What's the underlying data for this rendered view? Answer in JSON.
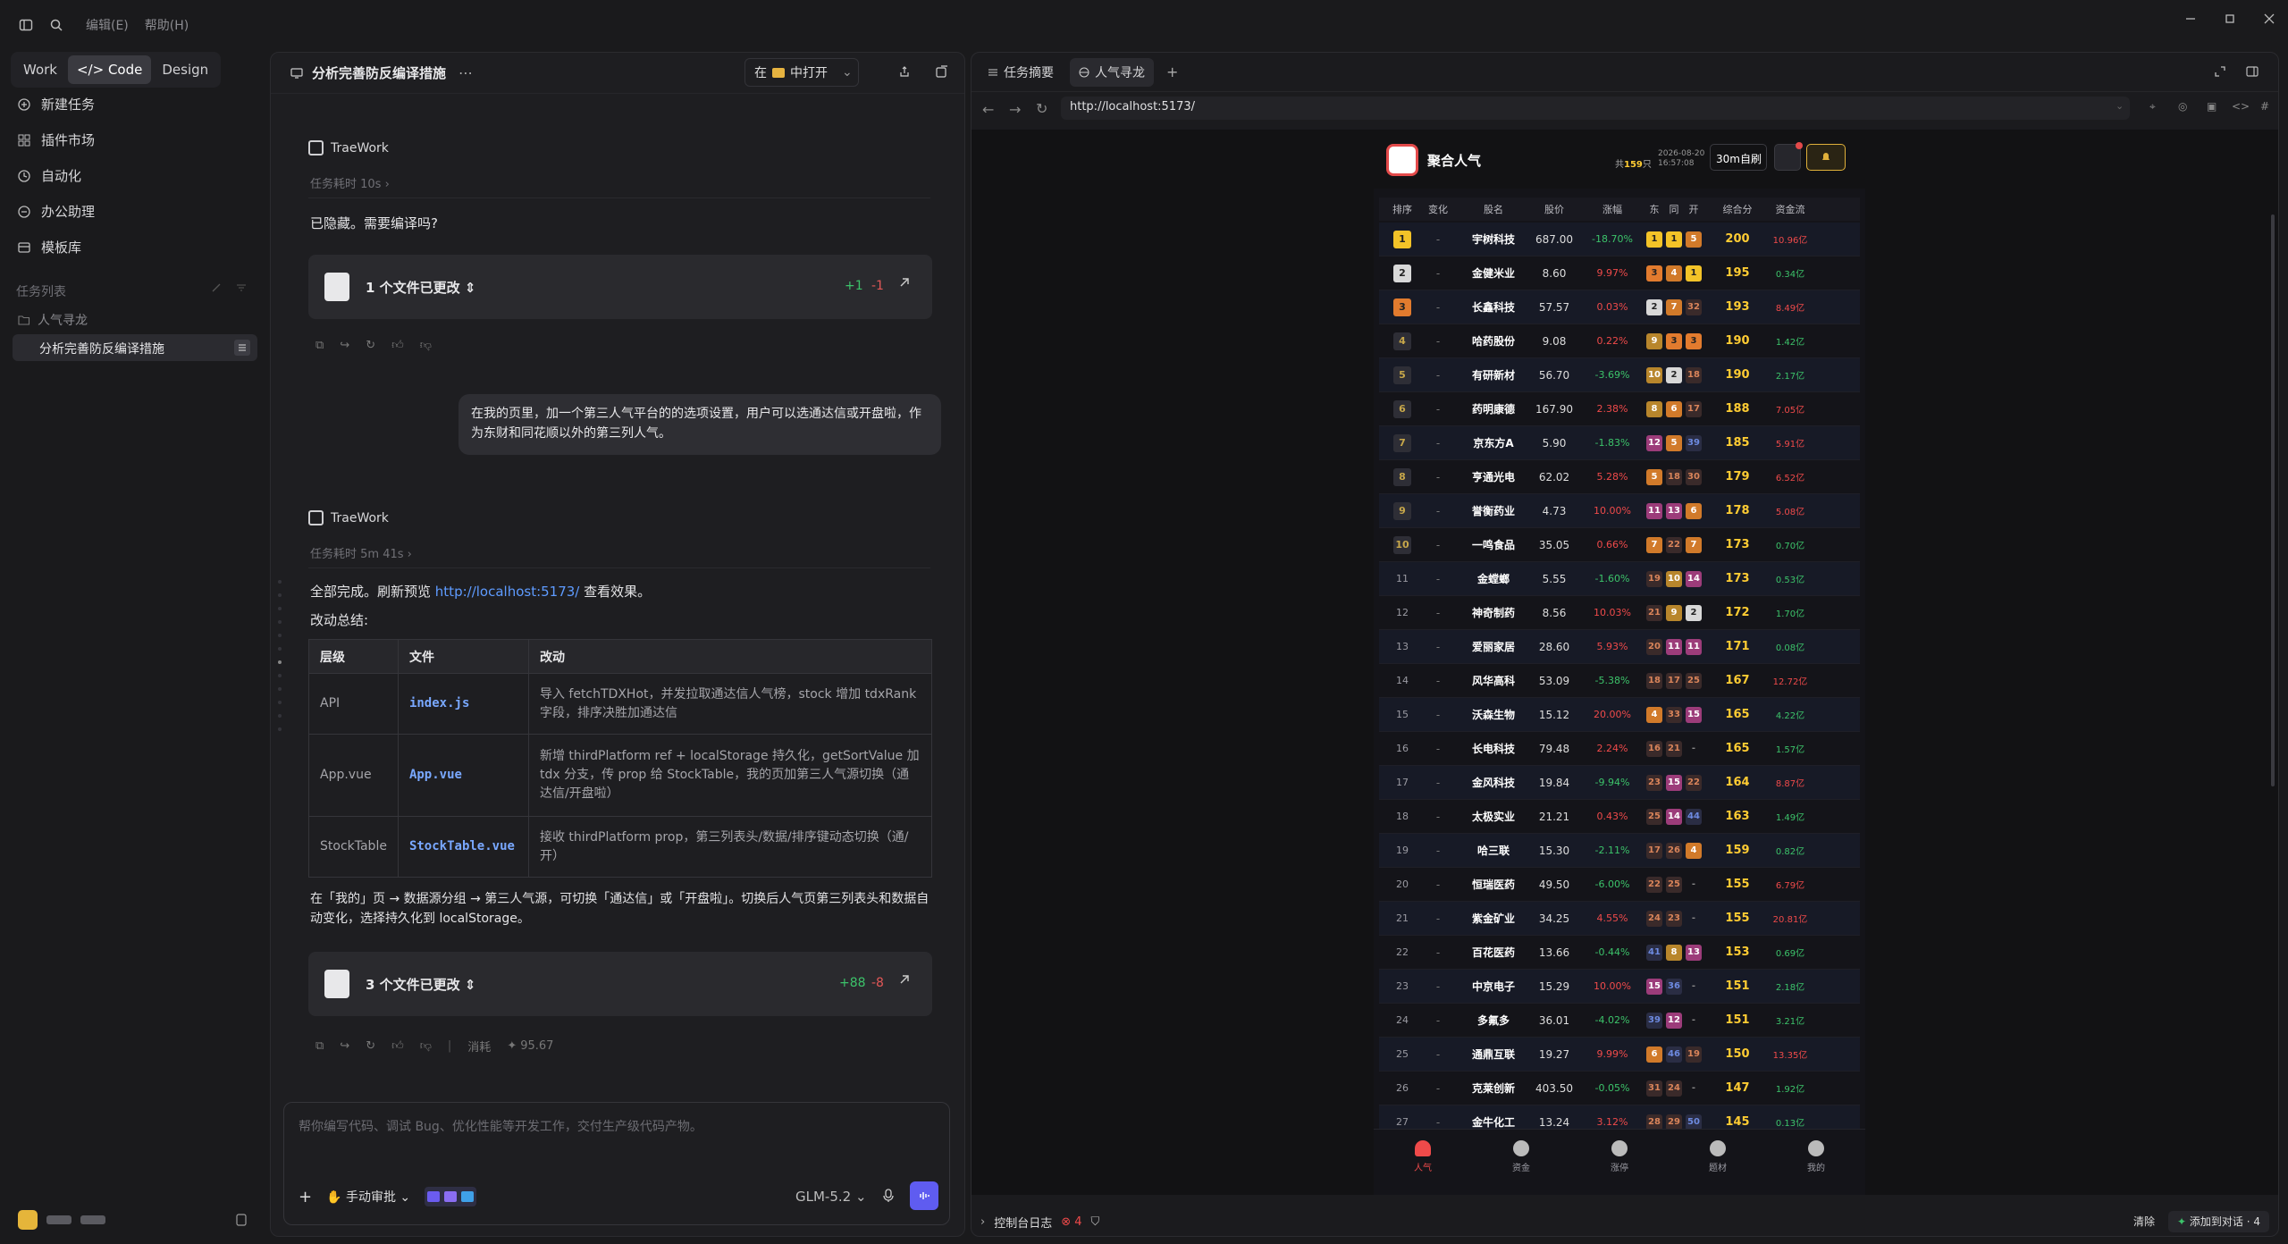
{
  "menu": {
    "edit": "编辑(E)",
    "help": "帮助(H)"
  },
  "modes": [
    "Work",
    "Code",
    "Design"
  ],
  "sidebar": {
    "nav": [
      "新建任务",
      "插件市场",
      "自动化",
      "办公助理",
      "模板库"
    ],
    "section": "任务列表",
    "project": "人气寻龙",
    "active_task": "分析完善防反编译措施"
  },
  "chat": {
    "title": "分析完善防反编译措施",
    "open_in": "在",
    "open_target": "中打开",
    "agent_name": "TraeWork",
    "first": {
      "elapsed": "任务耗时 10s",
      "reply": "已隐藏。需要编译吗?",
      "files": {
        "title": "1 个文件已更改",
        "add": "+1",
        "del": "-1"
      }
    },
    "user_msg": "在我的页里，加一个第三人气平台的的选项设置，用户可以选通达信或开盘啦，作为东财和同花顺以外的第三列人气。",
    "second": {
      "elapsed": "任务耗时 5m 41s",
      "done_prefix": "全部完成。刷新预览",
      "link": "http://localhost:5173/",
      "done_suffix": "查看效果。",
      "summary": "改动总结:",
      "table": {
        "headers": [
          "层级",
          "文件",
          "改动"
        ],
        "rows": [
          [
            "API",
            "index.js",
            "导入 fetchTDXHot，并发拉取通达信人气榜，stock 增加 tdxRank 字段，排序决胜加通达信"
          ],
          [
            "App.vue",
            "App.vue",
            "新增 thirdPlatform ref + localStorage 持久化，getSortValue 加 tdx 分支，传 prop 给 StockTable，我的页加第三人气源切换（通达信/开盘啦）"
          ],
          [
            "StockTable",
            "StockTable.vue",
            "接收 thirdPlatform prop，第三列表头/数据/排序键动态切换（通/开）"
          ]
        ]
      },
      "note": "在「我的」页 → 数据源分组 → 第三人气源，可切换「通达信」或「开盘啦」。切换后人气页第三列表头和数据自动变化，选择持久化到 localStorage。",
      "files": {
        "title": "3 个文件已更改",
        "add": "+88",
        "del": "-8"
      },
      "cost_label": "消耗",
      "cost": "95.67"
    },
    "composer": {
      "placeholder": "帮你编写代码、调试 Bug、优化性能等开发工作，交付生产级代码产物。",
      "mode": "手动审批",
      "model": "GLM-5.2"
    }
  },
  "browser": {
    "tabs": [
      "任务摘要",
      "人气寻龙"
    ],
    "url": "http://localhost:5173/",
    "console_label": "控制台日志",
    "error_count": "4",
    "clear": "清除",
    "add_to_chat": "添加到对话 · 4"
  },
  "app": {
    "title": "聚合人气",
    "count_prefix": "共",
    "count": "159",
    "count_suffix": "只",
    "date": "2026-08-20",
    "time": "16:57:08",
    "refresh": "30m自刷",
    "columns": [
      "排序",
      "变化",
      "股名",
      "股价",
      "涨幅",
      "东",
      "同",
      "开",
      "综合分",
      "资金流"
    ],
    "rows": [
      {
        "rank": "1",
        "chg": "-",
        "name": "宇树科技",
        "price": "687.00",
        "pct": "-18.70%",
        "d": "1",
        "t": "1",
        "k": "5",
        "score": "200",
        "flow": "10.96亿"
      },
      {
        "rank": "2",
        "chg": "-",
        "name": "金健米业",
        "price": "8.60",
        "pct": "9.97%",
        "d": "3",
        "t": "4",
        "k": "1",
        "score": "195",
        "flow": "0.34亿"
      },
      {
        "rank": "3",
        "chg": "-",
        "name": "长鑫科技",
        "price": "57.57",
        "pct": "0.03%",
        "d": "2",
        "t": "7",
        "k": "32",
        "score": "193",
        "flow": "8.49亿"
      },
      {
        "rank": "4",
        "chg": "-",
        "name": "哈药股份",
        "price": "9.08",
        "pct": "0.22%",
        "d": "9",
        "t": "3",
        "k": "3",
        "score": "190",
        "flow": "1.42亿"
      },
      {
        "rank": "5",
        "chg": "-",
        "name": "有研新材",
        "price": "56.70",
        "pct": "-3.69%",
        "d": "10",
        "t": "2",
        "k": "18",
        "score": "190",
        "flow": "2.17亿"
      },
      {
        "rank": "6",
        "chg": "-",
        "name": "药明康德",
        "price": "167.90",
        "pct": "2.38%",
        "d": "8",
        "t": "6",
        "k": "17",
        "score": "188",
        "flow": "7.05亿"
      },
      {
        "rank": "7",
        "chg": "-",
        "name": "京东方A",
        "price": "5.90",
        "pct": "-1.83%",
        "d": "12",
        "t": "5",
        "k": "39",
        "score": "185",
        "flow": "5.91亿"
      },
      {
        "rank": "8",
        "chg": "-",
        "name": "亨通光电",
        "price": "62.02",
        "pct": "5.28%",
        "d": "5",
        "t": "18",
        "k": "30",
        "score": "179",
        "flow": "6.52亿"
      },
      {
        "rank": "9",
        "chg": "-",
        "name": "誉衡药业",
        "price": "4.73",
        "pct": "10.00%",
        "d": "11",
        "t": "13",
        "k": "6",
        "score": "178",
        "flow": "5.08亿"
      },
      {
        "rank": "10",
        "chg": "-",
        "name": "一鸣食品",
        "price": "35.05",
        "pct": "0.66%",
        "d": "7",
        "t": "22",
        "k": "7",
        "score": "173",
        "flow": "0.70亿"
      },
      {
        "rank": "11",
        "chg": "-",
        "name": "金螳螂",
        "price": "5.55",
        "pct": "-1.60%",
        "d": "19",
        "t": "10",
        "k": "14",
        "score": "173",
        "flow": "0.53亿"
      },
      {
        "rank": "12",
        "chg": "-",
        "name": "神奇制药",
        "price": "8.56",
        "pct": "10.03%",
        "d": "21",
        "t": "9",
        "k": "2",
        "score": "172",
        "flow": "1.70亿"
      },
      {
        "rank": "13",
        "chg": "-",
        "name": "爱丽家居",
        "price": "28.60",
        "pct": "5.93%",
        "d": "20",
        "t": "11",
        "k": "11",
        "score": "171",
        "flow": "0.08亿"
      },
      {
        "rank": "14",
        "chg": "-",
        "name": "风华高科",
        "price": "53.09",
        "pct": "-5.38%",
        "d": "18",
        "t": "17",
        "k": "25",
        "score": "167",
        "flow": "12.72亿"
      },
      {
        "rank": "15",
        "chg": "-",
        "name": "沃森生物",
        "price": "15.12",
        "pct": "20.00%",
        "d": "4",
        "t": "33",
        "k": "15",
        "score": "165",
        "flow": "4.22亿"
      },
      {
        "rank": "16",
        "chg": "-",
        "name": "长电科技",
        "price": "79.48",
        "pct": "2.24%",
        "d": "16",
        "t": "21",
        "k": "-",
        "score": "165",
        "flow": "1.57亿"
      },
      {
        "rank": "17",
        "chg": "-",
        "name": "金风科技",
        "price": "19.84",
        "pct": "-9.94%",
        "d": "23",
        "t": "15",
        "k": "22",
        "score": "164",
        "flow": "8.87亿"
      },
      {
        "rank": "18",
        "chg": "-",
        "name": "太极实业",
        "price": "21.21",
        "pct": "0.43%",
        "d": "25",
        "t": "14",
        "k": "44",
        "score": "163",
        "flow": "1.49亿"
      },
      {
        "rank": "19",
        "chg": "-",
        "name": "哈三联",
        "price": "15.30",
        "pct": "-2.11%",
        "d": "17",
        "t": "26",
        "k": "4",
        "score": "159",
        "flow": "0.82亿"
      },
      {
        "rank": "20",
        "chg": "-",
        "name": "恒瑞医药",
        "price": "49.50",
        "pct": "-6.00%",
        "d": "22",
        "t": "25",
        "k": "-",
        "score": "155",
        "flow": "6.79亿"
      },
      {
        "rank": "21",
        "chg": "-",
        "name": "紫金矿业",
        "price": "34.25",
        "pct": "4.55%",
        "d": "24",
        "t": "23",
        "k": "-",
        "score": "155",
        "flow": "20.81亿"
      },
      {
        "rank": "22",
        "chg": "-",
        "name": "百花医药",
        "price": "13.66",
        "pct": "-0.44%",
        "d": "41",
        "t": "8",
        "k": "13",
        "score": "153",
        "flow": "0.69亿"
      },
      {
        "rank": "23",
        "chg": "-",
        "name": "中京电子",
        "price": "15.29",
        "pct": "10.00%",
        "d": "15",
        "t": "36",
        "k": "-",
        "score": "151",
        "flow": "2.18亿"
      },
      {
        "rank": "24",
        "chg": "-",
        "name": "多氟多",
        "price": "36.01",
        "pct": "-4.02%",
        "d": "39",
        "t": "12",
        "k": "-",
        "score": "151",
        "flow": "3.21亿"
      },
      {
        "rank": "25",
        "chg": "-",
        "name": "通鼎互联",
        "price": "19.27",
        "pct": "9.99%",
        "d": "6",
        "t": "46",
        "k": "19",
        "score": "150",
        "flow": "13.35亿"
      },
      {
        "rank": "26",
        "chg": "-",
        "name": "克莱创新",
        "price": "403.50",
        "pct": "-0.05%",
        "d": "31",
        "t": "24",
        "k": "-",
        "score": "147",
        "flow": "1.92亿"
      },
      {
        "rank": "27",
        "chg": "-",
        "name": "金牛化工",
        "price": "13.24",
        "pct": "3.12%",
        "d": "28",
        "t": "29",
        "k": "50",
        "score": "145",
        "flow": "0.13亿"
      }
    ],
    "nav": [
      "人气",
      "资金",
      "涨停",
      "题材",
      "我的"
    ]
  },
  "colors": {
    "accent": "#5f5cf0",
    "up": "#ef4a4a",
    "down": "#3cc36a",
    "score": "#ffcc33",
    "link": "#5e9bff"
  }
}
